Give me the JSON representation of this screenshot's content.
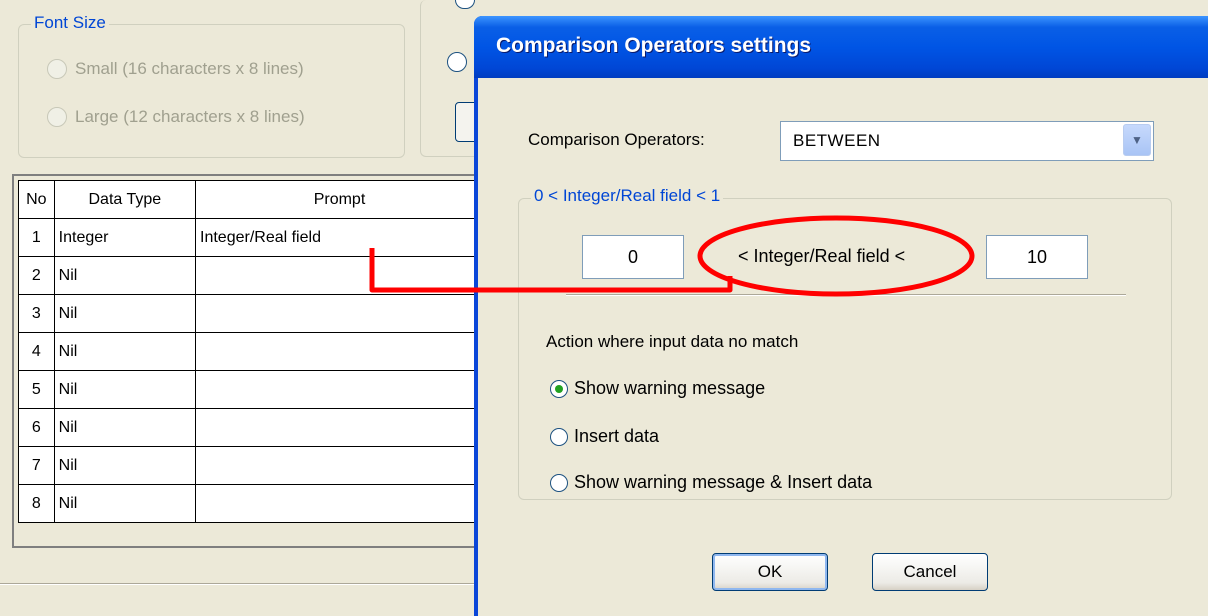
{
  "background": {
    "font_size_group": {
      "legend": "Font Size",
      "options": [
        "Small (16 characters x 8 lines)",
        "Large (12 characters x 8 lines)"
      ]
    },
    "table": {
      "headers": [
        "No",
        "Data Type",
        "Prompt"
      ],
      "rows": [
        {
          "no": "1",
          "type": "Integer",
          "prompt": "Integer/Real field"
        },
        {
          "no": "2",
          "type": "Nil",
          "prompt": ""
        },
        {
          "no": "3",
          "type": "Nil",
          "prompt": ""
        },
        {
          "no": "4",
          "type": "Nil",
          "prompt": ""
        },
        {
          "no": "5",
          "type": "Nil",
          "prompt": ""
        },
        {
          "no": "6",
          "type": "Nil",
          "prompt": ""
        },
        {
          "no": "7",
          "type": "Nil",
          "prompt": ""
        },
        {
          "no": "8",
          "type": "Nil",
          "prompt": ""
        }
      ]
    }
  },
  "dialog": {
    "title": "Comparison Operators settings",
    "operator_label": "Comparison Operators:",
    "operator_value": "BETWEEN",
    "range_group_legend": "0 < Integer/Real field < 1",
    "lower_value": "0",
    "range_label": "< Integer/Real field <",
    "upper_value": "10",
    "action_label": "Action where input data no match",
    "actions": [
      {
        "label": "Show warning message",
        "selected": true
      },
      {
        "label": "Insert data",
        "selected": false
      },
      {
        "label": "Show warning message & Insert  data",
        "selected": false
      }
    ],
    "ok_label": "OK",
    "cancel_label": "Cancel"
  },
  "colors": {
    "annotation": "#ff0000",
    "titlebar": "#0055e5",
    "legend_text": "#0046d5"
  }
}
